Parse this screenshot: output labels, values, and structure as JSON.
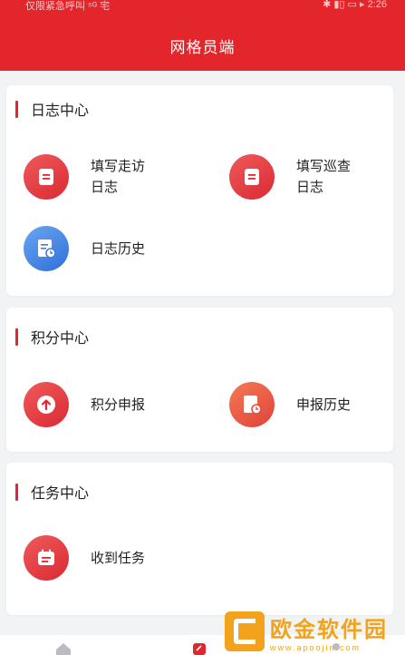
{
  "status_bar": {
    "left_text": "仅限紧急呼叫 ⁵ᴳ 宅",
    "right_text": "✱ ▮▯ ▭ ▸ 2:26"
  },
  "header": {
    "title": "网格员端"
  },
  "sections": [
    {
      "title": "日志中心",
      "items": [
        {
          "label_line1": "填写走访",
          "label_line2": "日志",
          "icon": "doc-icon",
          "color": "#e3262b"
        },
        {
          "label_line1": "填写巡查",
          "label_line2": "日志",
          "icon": "doc-icon",
          "color": "#e3262b"
        },
        {
          "label_line1": "日志历史",
          "label_line2": "",
          "icon": "history-doc-icon",
          "color": "#3d7ce0"
        }
      ]
    },
    {
      "title": "积分中心",
      "items": [
        {
          "label_line1": "积分申报",
          "label_line2": "",
          "icon": "upload-icon",
          "color": "#e3262b"
        },
        {
          "label_line1": "申报历史",
          "label_line2": "",
          "icon": "clock-doc-icon",
          "color": "#ea4c3d"
        }
      ]
    },
    {
      "title": "任务中心",
      "items": [
        {
          "label_line1": "收到任务",
          "label_line2": "",
          "icon": "calendar-icon",
          "color": "#e3262b"
        }
      ]
    }
  ],
  "watermark": {
    "text": "欧金软件园",
    "url": "www.apoojin.com"
  },
  "colors": {
    "brand_red": "#e3262b",
    "background": "#f2f3f5",
    "watermark": "#f2a31b"
  }
}
